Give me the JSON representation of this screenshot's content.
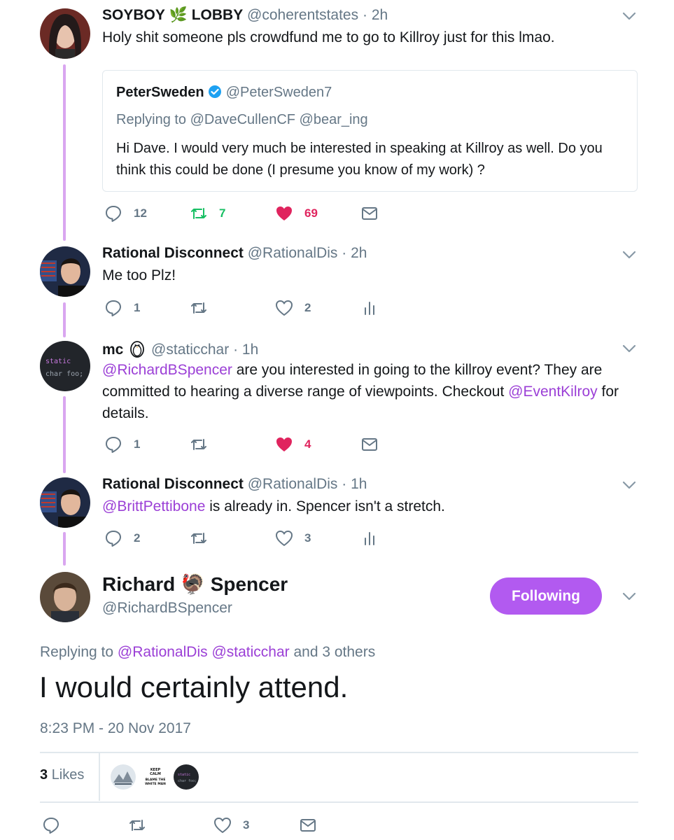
{
  "tweets": [
    {
      "name": "SOYBOY",
      "name_emoji": "🌿",
      "name_rest": "LOBBY",
      "handle": "@coherentstates",
      "dot": "·",
      "time": "2h",
      "text": "Holy shit someone pls crowdfund me to go to Killroy just for this lmao.",
      "quote": {
        "name": "PeterSweden",
        "handle": "@PeterSweden7",
        "replying_prefix": "Replying to",
        "replying_to": "@DaveCullenCF @bear_ing",
        "text": "Hi Dave. I would very much be interested in speaking at Killroy as well. Do you think this could be done (I presume you know of my work) ?"
      },
      "replies": "12",
      "retweets": "7",
      "likes": "69",
      "liked": true,
      "retweeted": true
    },
    {
      "name": "Rational Disconnect",
      "handle": "@RationalDis",
      "dot": "·",
      "time": "2h",
      "text": "Me too Plz!",
      "replies": "1",
      "likes": "2"
    },
    {
      "name": "mc",
      "handle": "@staticchar",
      "dot": "·",
      "time": "1h",
      "mention1": "@RichardBSpencer",
      "text_mid": " are you interested in going to the killroy event? They are committed to hearing a diverse range of viewpoints. Checkout ",
      "mention2": "@EventKilroy",
      "text_end": " for details.",
      "replies": "1",
      "likes": "4",
      "liked": true,
      "avatar_lines": [
        "static",
        "char foo;"
      ]
    },
    {
      "name": "Rational Disconnect",
      "handle": "@RationalDis",
      "dot": "·",
      "time": "1h",
      "mention1": "@BrittPettibone",
      "text_end": " is already in. Spencer isn't a stretch.",
      "replies": "2",
      "likes": "3"
    }
  ],
  "main": {
    "name_first": "Richard",
    "name_emoji": "🦃",
    "name_last": "Spencer",
    "handle": "@RichardBSpencer",
    "follow_label": "Following",
    "replying_prefix": "Replying to",
    "replying_mentions": "@RationalDis @staticchar",
    "replying_suffix": "and 3 others",
    "text": "I would certainly attend.",
    "timestamp": "8:23 PM - 20 Nov 2017",
    "likes_count": "3",
    "likes_label": "Likes",
    "liker_badge_text": [
      "KEEP",
      "CALM",
      "BLAME THE",
      "WHITE MAN"
    ],
    "liker_static_lines": [
      "static",
      "char foo;"
    ],
    "action_likes": "3"
  },
  "colors": {
    "accent": "#9b3fd6",
    "follow_button": "#b25af0",
    "thread_line": "#d9a6f0",
    "like_red": "#e0245e",
    "retweet_green": "#17bf63",
    "muted": "#657786"
  }
}
